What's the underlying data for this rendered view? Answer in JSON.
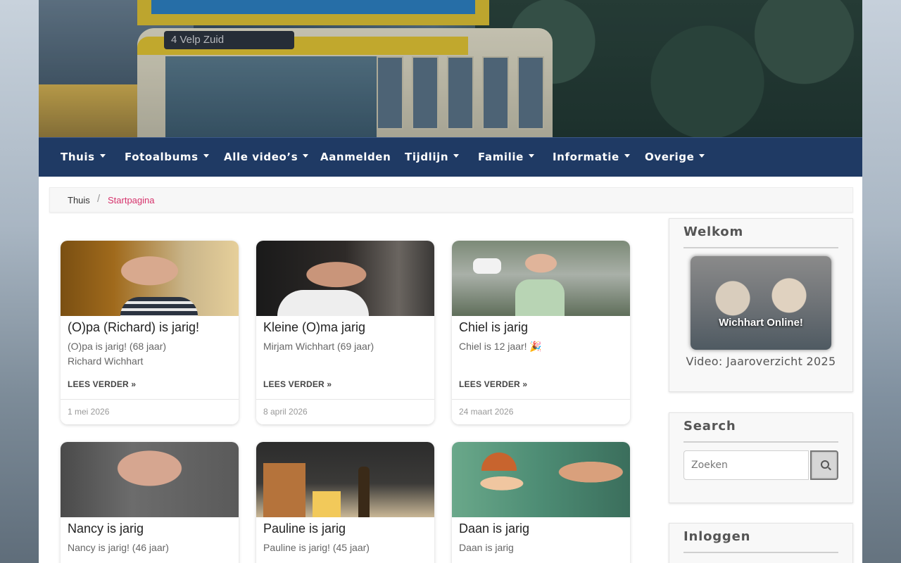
{
  "banner": {
    "bus_sign": "4   Velp Zuid"
  },
  "nav": [
    {
      "label": "Thuis",
      "dropdown": true
    },
    {
      "label": "Fotoalbums",
      "dropdown": true
    },
    {
      "label": "Alle video’s",
      "dropdown": true
    },
    {
      "label": "Aanmelden",
      "dropdown": false
    },
    {
      "label": "Tijdlijn",
      "dropdown": true
    },
    {
      "label": "Familie",
      "dropdown": true
    },
    {
      "label": "Informatie",
      "dropdown": true
    },
    {
      "label": "Overige",
      "dropdown": true
    }
  ],
  "breadcrumb": {
    "home": "Thuis",
    "separator": "/",
    "current": "Startpagina"
  },
  "cards": [
    {
      "title": "(O)pa (Richard) is jarig!",
      "text": "(O)pa is jarig! (68 jaar)\nRichard Wichhart",
      "more": "LEES VERDER »",
      "date": "1 mei 2026"
    },
    {
      "title": "Kleine (O)ma jarig",
      "text": "Mirjam Wichhart (69 jaar)",
      "more": "LEES VERDER »",
      "date": "8 april 2026"
    },
    {
      "title": "Chiel is jarig",
      "text": "Chiel is 12 jaar! 🎉",
      "more": "LEES VERDER »",
      "date": "24 maart 2026"
    },
    {
      "title": "Nancy is jarig",
      "text": "Nancy is jarig! (46 jaar)"
    },
    {
      "title": "Pauline is jarig",
      "text": "Pauline is jarig! (45 jaar)"
    },
    {
      "title": "Daan is jarig",
      "text": "Daan is jarig"
    }
  ],
  "sidebar": {
    "welcome": {
      "title": "Welkom",
      "image_text": "Wichhart Online!",
      "caption": "Video: Jaaroverzicht 2025"
    },
    "search": {
      "title": "Search",
      "placeholder": "Zoeken"
    },
    "login": {
      "title": "Inloggen"
    }
  },
  "colors": {
    "nav_bg": "#1f3a64",
    "breadcrumb_active": "#d6336c"
  }
}
